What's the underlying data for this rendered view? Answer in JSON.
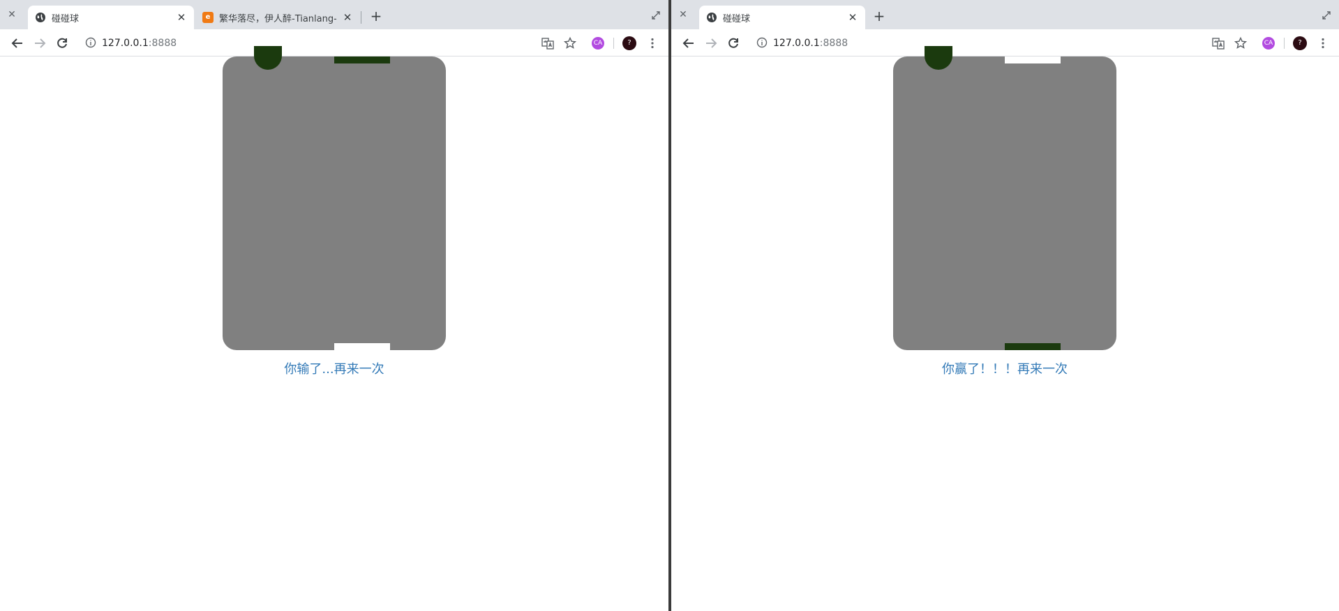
{
  "left_window": {
    "tabs": [
      {
        "title": "碰碰球",
        "icon": "globe-icon"
      },
      {
        "title": "繁华落尽，伊人醉-Tianlang-古代",
        "icon": "site-icon"
      }
    ],
    "url_host": "127.0.0.1",
    "url_port": ":8888",
    "game": {
      "top_paddle_color": "#1b3a0e",
      "bottom_paddle_color": "#ffffff",
      "result_text": "你输了...",
      "retry_link": "再来一次"
    }
  },
  "right_window": {
    "tabs": [
      {
        "title": "碰碰球",
        "icon": "globe-icon"
      }
    ],
    "url_host": "127.0.0.1",
    "url_port": ":8888",
    "game": {
      "top_paddle_color": "#ffffff",
      "bottom_paddle_color": "#1b3a0e",
      "result_text": "你赢了！！！",
      "retry_link": "再来一次"
    }
  },
  "colors": {
    "board": "#808080",
    "ball": "#1b3a0e",
    "link": "#337ab7"
  }
}
